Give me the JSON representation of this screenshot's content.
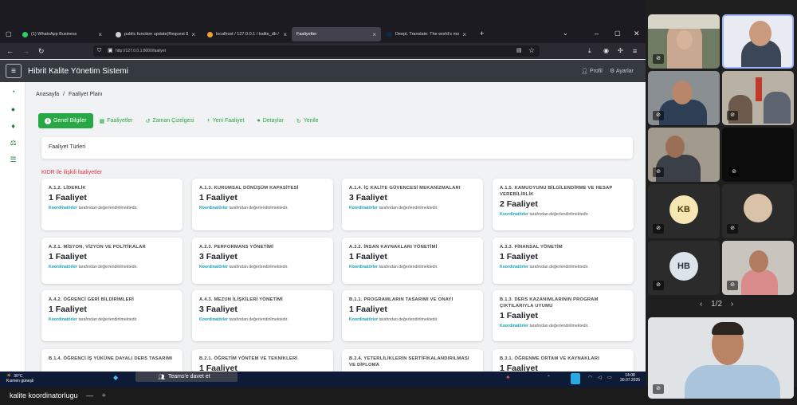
{
  "browser": {
    "tabs": [
      {
        "label": "(1) WhatsApp Business",
        "icon_color": "#25d366",
        "active": false
      },
      {
        "label": "public function update(Request $requ",
        "icon_color": "#cfcfcf",
        "active": false
      },
      {
        "label": "localhost / 127.0.0.1 / kalite_db / faali",
        "icon_color": "#f0a030",
        "active": false
      },
      {
        "label": "Faaliyetler",
        "icon_color": "",
        "active": true
      },
      {
        "label": "DeepL Translate: The world's most acc",
        "icon_color": "#0f2b46",
        "active": false
      }
    ],
    "url": "http://127.0.0.1:8000/faaliyet"
  },
  "app": {
    "name": "Hibrit Kalite Yönetim Sistemi",
    "profile_label": "Profil",
    "settings_label": "Ayarlar",
    "breadcrumb_home": "Anasayfa",
    "breadcrumb_sep": "/",
    "breadcrumb_current": "Faaliyet Planı",
    "toolbar": [
      {
        "label": "Genel Bilgiler",
        "icon": "i",
        "active": true
      },
      {
        "label": "Faaliyetler",
        "icon": "▦",
        "active": false
      },
      {
        "label": "Zaman Çizelgesi",
        "icon": "↺",
        "active": false
      },
      {
        "label": "Yeni Faaliyet",
        "icon": "+",
        "active": false
      },
      {
        "label": "Detaylar",
        "icon": "●",
        "active": false
      },
      {
        "label": "Yenile",
        "icon": "↻",
        "active": false
      }
    ],
    "types_title": "Faaliyet Türleri",
    "section_label": "KIDR ile ilişkili faaliyetler",
    "cards": [
      {
        "title": "A.1.2. LİDERLİK",
        "count": "1 Faaliyet",
        "coord": "Koordinatörler",
        "note": " tarafından değerlendirilmektedir."
      },
      {
        "title": "A.1.3. KURUMSAL DÖNÜŞÜM KAPASİTESİ",
        "count": "1 Faaliyet",
        "coord": "Koordinatörler",
        "note": " tarafından değerlendirilmektedir."
      },
      {
        "title": "A.1.4. İÇ KALİTE GÜVENCESİ MEKANİZMALARI",
        "count": "3 Faaliyet",
        "coord": "Koordinatörler",
        "note": " tarafından değerlendirilmektedir."
      },
      {
        "title": "A.1.5. KAMUOYUNU BİLGİLENDİRME VE HESAP VEREBİLİRLİK",
        "count": "2 Faaliyet",
        "coord": "Koordinatörler",
        "note": " tarafından değerlendirilmektedir."
      },
      {
        "title": "A.2.1. MİSYON, VİZYON VE POLİTİKALAR",
        "count": "1 Faaliyet",
        "coord": "Koordinatörler",
        "note": " tarafından değerlendirilmektedir."
      },
      {
        "title": "A.2.3. PERFORMANS YÖNETİMİ",
        "count": "3 Faaliyet",
        "coord": "Koordinatörler",
        "note": " tarafından değerlendirilmektedir."
      },
      {
        "title": "A.3.2. İNSAN KAYNAKLARI YÖNETİMİ",
        "count": "1 Faaliyet",
        "coord": "Koordinatörler",
        "note": " tarafından değerlendirilmektedir."
      },
      {
        "title": "A.3.3. FİNANSAL YÖNETİM",
        "count": "1 Faaliyet",
        "coord": "Koordinatörler",
        "note": " tarafından değerlendirilmektedir."
      },
      {
        "title": "A.4.2. ÖĞRENCİ GERİ BİLDİRİMLERİ",
        "count": "1 Faaliyet",
        "coord": "Koordinatörler",
        "note": " tarafından değerlendirilmektedir."
      },
      {
        "title": "A.4.3. MEZUN İLİŞKİLERİ YÖNETİMİ",
        "count": "3 Faaliyet",
        "coord": "Koordinatörler",
        "note": " tarafından değerlendirilmektedir."
      },
      {
        "title": "B.1.1. PROGRAMLARIN TASARIMI VE ONAYI",
        "count": "1 Faaliyet",
        "coord": "Koordinatörler",
        "note": " tarafından değerlendirilmektedir."
      },
      {
        "title": "B.1.3. DERS KAZANIMLARININ PROGRAM ÇIKTILARIYLA UYUMU",
        "count": "1 Faaliyet",
        "coord": "Koordinatörler",
        "note": " tarafından değerlendirilmektedir."
      },
      {
        "title": "B.1.4. ÖĞRENCİ İŞ YÜKÜNE DAYALI DERS TASARIMI",
        "count": "",
        "coord": "",
        "note": ""
      },
      {
        "title": "B.2.1. ÖĞRETİM YÖNTEM VE TEKNİKLERİ",
        "count": "1 Faaliyet",
        "coord": "",
        "note": ""
      },
      {
        "title": "B.2.4. YETERLİLİKLERİN SERTİFİKALANDIRILMASI VE DİPLOMA",
        "count": "",
        "coord": "",
        "note": ""
      },
      {
        "title": "B.3.1. ÖĞRENME ORTAM VE KAYNAKLARI",
        "count": "1 Faaliyet",
        "coord": "",
        "note": ""
      }
    ]
  },
  "taskbar": {
    "weather_temp": "30°C",
    "weather_desc": "Kısmen güneşli",
    "teams_label": "Teams'e davet et",
    "time": "14:08",
    "date": "30.07.2025"
  },
  "meeting": {
    "name": "kalite koordinatorlugu",
    "pager": "1/2",
    "participants": [
      {
        "initials": "KB",
        "color": "#f5e6b3",
        "text_color": "#4a3b00"
      },
      {
        "initials": "HB",
        "color": "#dde3ea",
        "text_color": "#2c3340"
      }
    ]
  }
}
